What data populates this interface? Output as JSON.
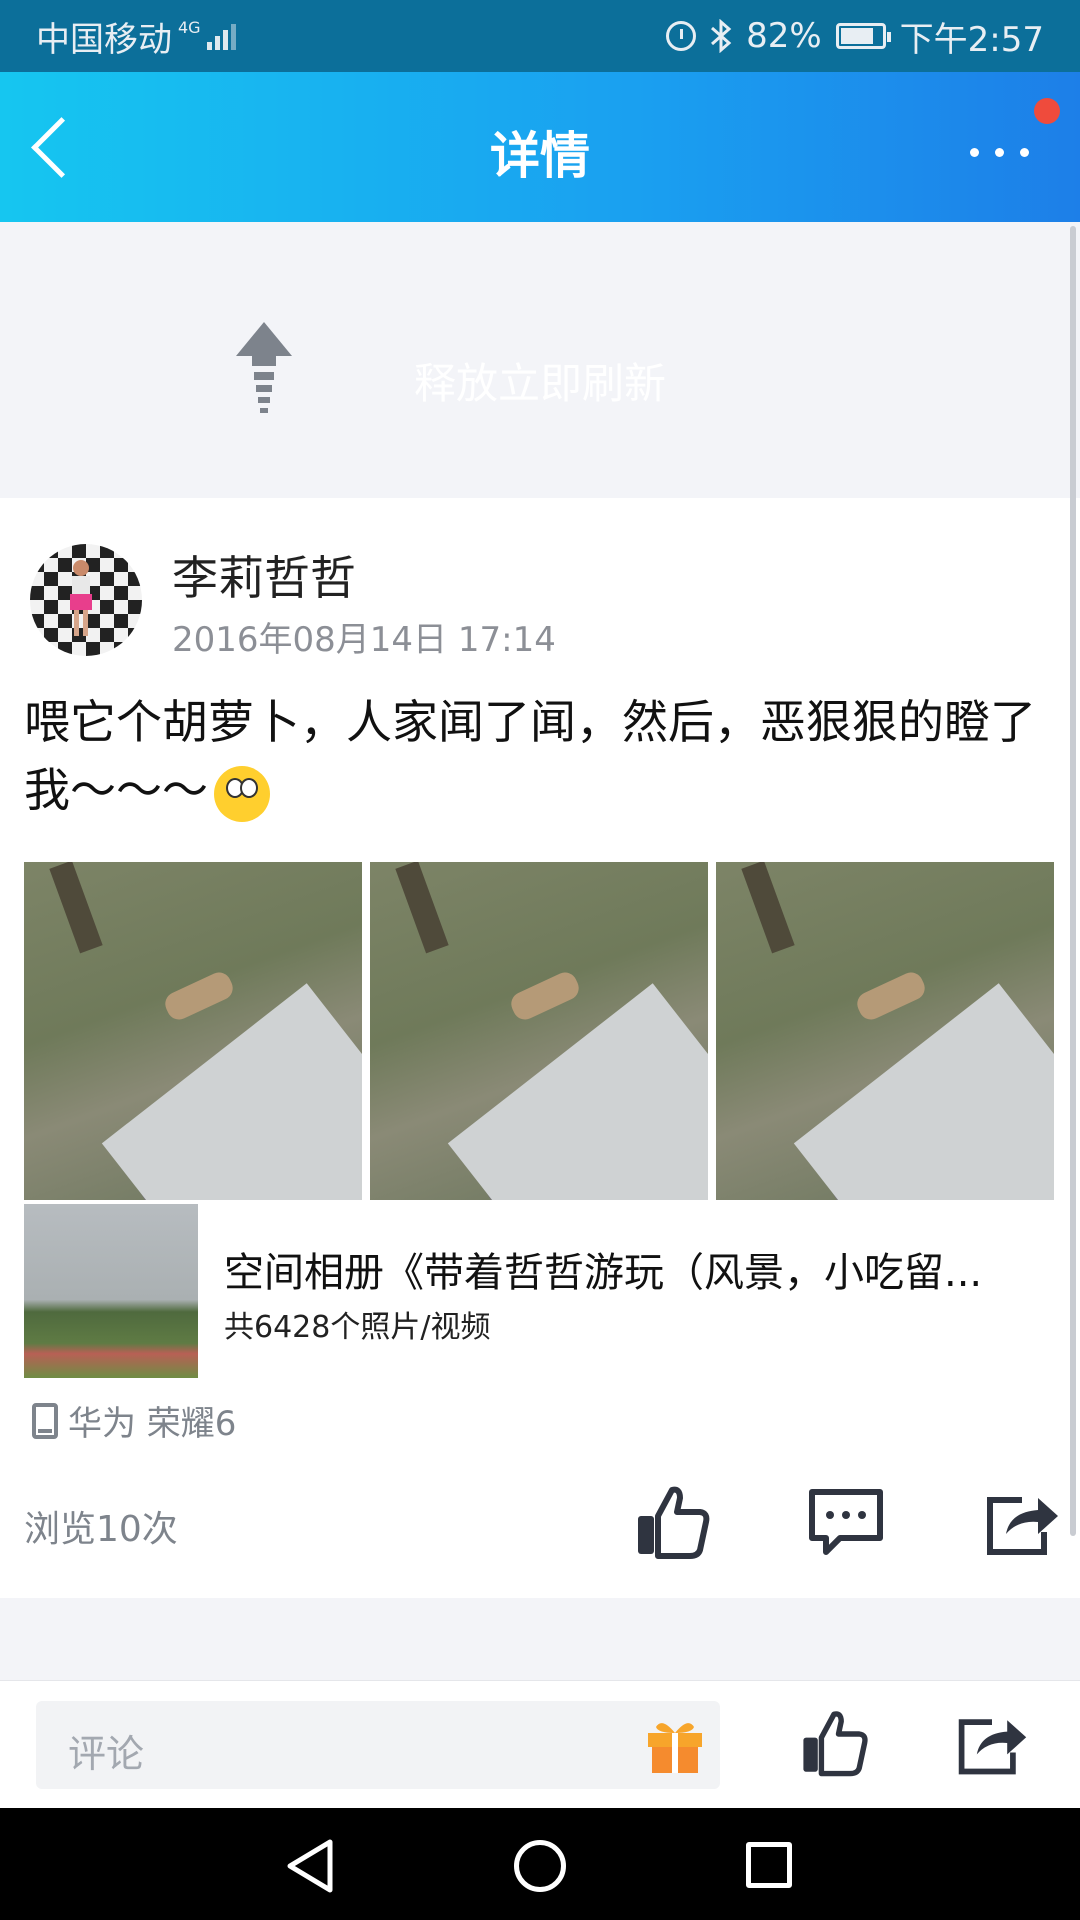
{
  "status_bar": {
    "carrier": "中国移动",
    "network": "4G",
    "battery": "82%",
    "battery_level": 0.82,
    "time": "下午2:57"
  },
  "header": {
    "title": "详情",
    "back_icon": "chevron-left-icon",
    "more_icon": "more-dots-icon",
    "notification_dot_color": "#ef4b3c",
    "gradient": [
      "#16c6f0",
      "#1d7fe8"
    ]
  },
  "refresh": {
    "text": "释放立即刷新"
  },
  "post": {
    "username": "李莉哲哲",
    "time": "2016年08月14日 17:14",
    "text": "喂它个胡萝卜，人家闻了闻，然后，恶狠狠的瞪了我～～～",
    "emoji": "surprised-face-emoji",
    "photos": [
      "photo-1",
      "photo-2",
      "photo-3"
    ],
    "album": {
      "title": "空间相册《带着哲哲游玩（风景，小吃留...",
      "count": "共6428个照片/视频"
    },
    "device": "华为 荣耀6",
    "views": "浏览10次"
  },
  "comment_bar": {
    "placeholder": "评论"
  }
}
